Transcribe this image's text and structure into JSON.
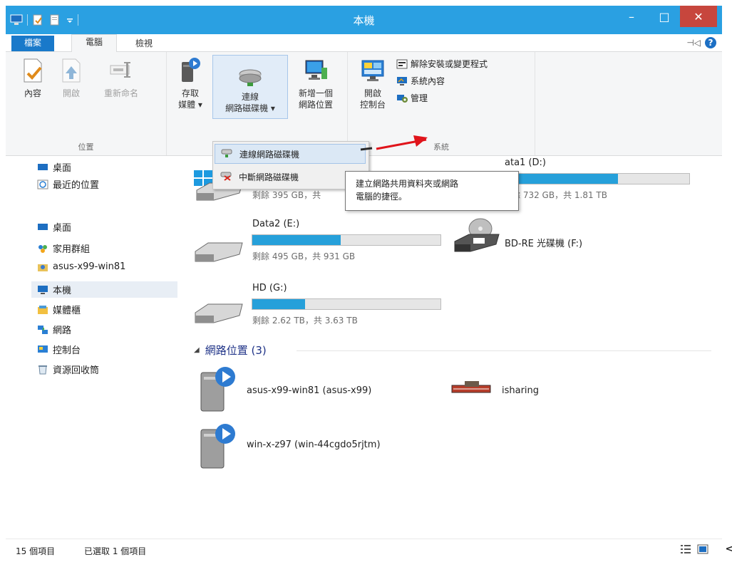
{
  "window": {
    "title": "本機",
    "minimize": "–",
    "maximize": "□",
    "close": "✕"
  },
  "tabs": {
    "file": "檔案",
    "computer": "電腦",
    "view": "檢視"
  },
  "ribbon": {
    "location": {
      "label": "位置",
      "properties": "內容",
      "open": "開啟",
      "rename": "重新命名"
    },
    "network": {
      "access_media_1": "存取",
      "access_media_2": "媒體 ▾",
      "map_drive_1": "連線",
      "map_drive_2": "網路磁碟機 ▾",
      "add_location_1": "新增一個",
      "add_location_2": "網路位置"
    },
    "system": {
      "label": "系統",
      "control_panel_1": "開啟",
      "control_panel_2": "控制台",
      "uninstall": "解除安裝或變更程式",
      "sys_props": "系統內容",
      "manage": "管理"
    }
  },
  "dropdown": {
    "map": "連線網路磁碟機",
    "disconnect": "中斷網路磁碟機"
  },
  "tooltip": {
    "line1": "建立網路共用資料夾或網路",
    "line2": "電腦的捷徑。"
  },
  "nav": {
    "items": [
      {
        "label": "桌面"
      },
      {
        "label": "最近的位置"
      },
      {
        "label": "桌面"
      },
      {
        "label": "家用群組"
      },
      {
        "label": "asus-x99-win81"
      },
      {
        "label": "本機"
      },
      {
        "label": "媒體櫃"
      },
      {
        "label": "網路"
      },
      {
        "label": "控制台"
      },
      {
        "label": "資源回收筒"
      }
    ]
  },
  "drives": [
    {
      "name": "",
      "free": "剩餘 395 GB，共",
      "fill": 0.35
    },
    {
      "name": "ata1 (D:)",
      "free": "餘 732 GB，共 1.81 TB",
      "fill": 0.6
    },
    {
      "name": "Data2 (E:)",
      "free": "剩餘 495 GB，共 931 GB",
      "fill": 0.47
    },
    {
      "name": "BD-RE 光碟機 (F:)",
      "free": "",
      "fill": 0
    },
    {
      "name": "HD (G:)",
      "free": "剩餘 2.62 TB，共 3.63 TB",
      "fill": 0.28
    }
  ],
  "network_section": {
    "title": "網路位置 (3)",
    "locations": [
      {
        "label": "asus-x99-win81 (asus-x99)"
      },
      {
        "label": "isharing"
      },
      {
        "label": "win-x-z97 (win-44cgdo5rjtm)"
      }
    ]
  },
  "status": {
    "items": "15 個項目",
    "selected": "已選取 1 個項目"
  },
  "stray_char": "<",
  "colors": {
    "titlebar": "#2aa0e2",
    "file_tab": "#1979ca",
    "close": "#c7463d",
    "drive_fill": "#26a0da",
    "section_text": "#1e3287",
    "arrow": "#e0141b"
  }
}
